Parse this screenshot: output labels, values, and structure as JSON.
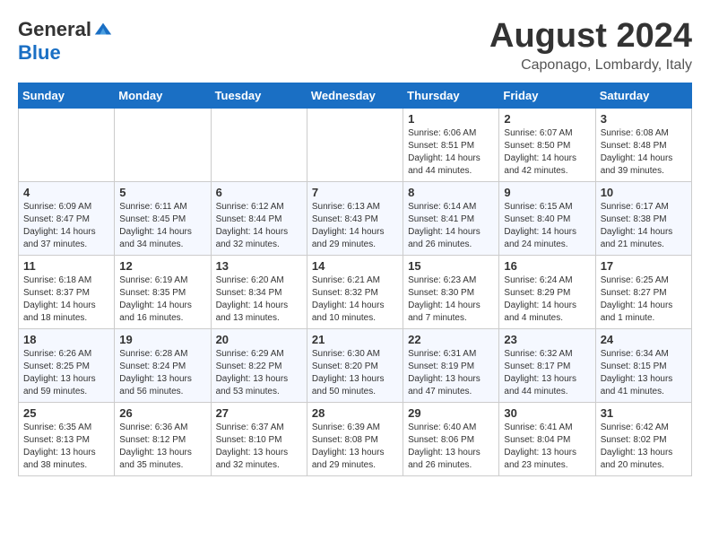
{
  "header": {
    "logo_general": "General",
    "logo_blue": "Blue",
    "month_title": "August 2024",
    "location": "Caponago, Lombardy, Italy"
  },
  "days_of_week": [
    "Sunday",
    "Monday",
    "Tuesday",
    "Wednesday",
    "Thursday",
    "Friday",
    "Saturday"
  ],
  "weeks": [
    [
      {
        "day": "",
        "info": ""
      },
      {
        "day": "",
        "info": ""
      },
      {
        "day": "",
        "info": ""
      },
      {
        "day": "",
        "info": ""
      },
      {
        "day": "1",
        "info": "Sunrise: 6:06 AM\nSunset: 8:51 PM\nDaylight: 14 hours and 44 minutes."
      },
      {
        "day": "2",
        "info": "Sunrise: 6:07 AM\nSunset: 8:50 PM\nDaylight: 14 hours and 42 minutes."
      },
      {
        "day": "3",
        "info": "Sunrise: 6:08 AM\nSunset: 8:48 PM\nDaylight: 14 hours and 39 minutes."
      }
    ],
    [
      {
        "day": "4",
        "info": "Sunrise: 6:09 AM\nSunset: 8:47 PM\nDaylight: 14 hours and 37 minutes."
      },
      {
        "day": "5",
        "info": "Sunrise: 6:11 AM\nSunset: 8:45 PM\nDaylight: 14 hours and 34 minutes."
      },
      {
        "day": "6",
        "info": "Sunrise: 6:12 AM\nSunset: 8:44 PM\nDaylight: 14 hours and 32 minutes."
      },
      {
        "day": "7",
        "info": "Sunrise: 6:13 AM\nSunset: 8:43 PM\nDaylight: 14 hours and 29 minutes."
      },
      {
        "day": "8",
        "info": "Sunrise: 6:14 AM\nSunset: 8:41 PM\nDaylight: 14 hours and 26 minutes."
      },
      {
        "day": "9",
        "info": "Sunrise: 6:15 AM\nSunset: 8:40 PM\nDaylight: 14 hours and 24 minutes."
      },
      {
        "day": "10",
        "info": "Sunrise: 6:17 AM\nSunset: 8:38 PM\nDaylight: 14 hours and 21 minutes."
      }
    ],
    [
      {
        "day": "11",
        "info": "Sunrise: 6:18 AM\nSunset: 8:37 PM\nDaylight: 14 hours and 18 minutes."
      },
      {
        "day": "12",
        "info": "Sunrise: 6:19 AM\nSunset: 8:35 PM\nDaylight: 14 hours and 16 minutes."
      },
      {
        "day": "13",
        "info": "Sunrise: 6:20 AM\nSunset: 8:34 PM\nDaylight: 14 hours and 13 minutes."
      },
      {
        "day": "14",
        "info": "Sunrise: 6:21 AM\nSunset: 8:32 PM\nDaylight: 14 hours and 10 minutes."
      },
      {
        "day": "15",
        "info": "Sunrise: 6:23 AM\nSunset: 8:30 PM\nDaylight: 14 hours and 7 minutes."
      },
      {
        "day": "16",
        "info": "Sunrise: 6:24 AM\nSunset: 8:29 PM\nDaylight: 14 hours and 4 minutes."
      },
      {
        "day": "17",
        "info": "Sunrise: 6:25 AM\nSunset: 8:27 PM\nDaylight: 14 hours and 1 minute."
      }
    ],
    [
      {
        "day": "18",
        "info": "Sunrise: 6:26 AM\nSunset: 8:25 PM\nDaylight: 13 hours and 59 minutes."
      },
      {
        "day": "19",
        "info": "Sunrise: 6:28 AM\nSunset: 8:24 PM\nDaylight: 13 hours and 56 minutes."
      },
      {
        "day": "20",
        "info": "Sunrise: 6:29 AM\nSunset: 8:22 PM\nDaylight: 13 hours and 53 minutes."
      },
      {
        "day": "21",
        "info": "Sunrise: 6:30 AM\nSunset: 8:20 PM\nDaylight: 13 hours and 50 minutes."
      },
      {
        "day": "22",
        "info": "Sunrise: 6:31 AM\nSunset: 8:19 PM\nDaylight: 13 hours and 47 minutes."
      },
      {
        "day": "23",
        "info": "Sunrise: 6:32 AM\nSunset: 8:17 PM\nDaylight: 13 hours and 44 minutes."
      },
      {
        "day": "24",
        "info": "Sunrise: 6:34 AM\nSunset: 8:15 PM\nDaylight: 13 hours and 41 minutes."
      }
    ],
    [
      {
        "day": "25",
        "info": "Sunrise: 6:35 AM\nSunset: 8:13 PM\nDaylight: 13 hours and 38 minutes."
      },
      {
        "day": "26",
        "info": "Sunrise: 6:36 AM\nSunset: 8:12 PM\nDaylight: 13 hours and 35 minutes."
      },
      {
        "day": "27",
        "info": "Sunrise: 6:37 AM\nSunset: 8:10 PM\nDaylight: 13 hours and 32 minutes."
      },
      {
        "day": "28",
        "info": "Sunrise: 6:39 AM\nSunset: 8:08 PM\nDaylight: 13 hours and 29 minutes."
      },
      {
        "day": "29",
        "info": "Sunrise: 6:40 AM\nSunset: 8:06 PM\nDaylight: 13 hours and 26 minutes."
      },
      {
        "day": "30",
        "info": "Sunrise: 6:41 AM\nSunset: 8:04 PM\nDaylight: 13 hours and 23 minutes."
      },
      {
        "day": "31",
        "info": "Sunrise: 6:42 AM\nSunset: 8:02 PM\nDaylight: 13 hours and 20 minutes."
      }
    ]
  ]
}
